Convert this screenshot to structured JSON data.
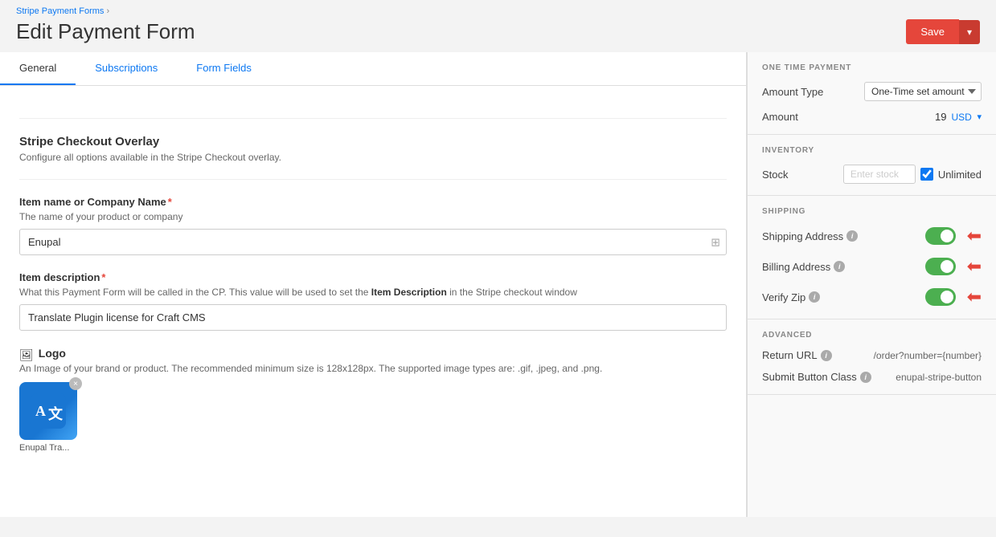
{
  "breadcrumb": {
    "parent": "Stripe Payment Forms",
    "separator": "›"
  },
  "page": {
    "title": "Edit Payment Form"
  },
  "toolbar": {
    "save_label": "Save",
    "save_dropdown_label": "▾"
  },
  "tabs": [
    {
      "id": "general",
      "label": "General",
      "active": true
    },
    {
      "id": "subscriptions",
      "label": "Subscriptions",
      "active": false
    },
    {
      "id": "form-fields",
      "label": "Form Fields",
      "active": false
    }
  ],
  "form": {
    "stripe_checkout": {
      "title": "Stripe Checkout Overlay",
      "subtitle": "Configure all options available in the Stripe Checkout overlay."
    },
    "item_name": {
      "label": "Item name or Company Name",
      "required": true,
      "desc": "The name of your product or company",
      "value": "Enupal"
    },
    "item_description": {
      "label": "Item description",
      "required": true,
      "desc_prefix": "What this Payment Form will be called in the CP. This value will be used to set the ",
      "desc_bold": "Item Description",
      "desc_suffix": " in the Stripe checkout window",
      "value": "Translate Plugin license for Craft CMS"
    },
    "logo": {
      "label": "Logo",
      "icon": "🖼",
      "desc": "An Image of your brand or product. The recommended minimum size is 128x128px. The supported image types are: .gif, .jpeg, and .png.",
      "filename": "Enupal Tra...",
      "remove_label": "×"
    }
  },
  "right_panel": {
    "one_time_payment": {
      "section_title": "ONE TIME PAYMENT",
      "amount_type_label": "Amount Type",
      "amount_type_value": "One-Time set amount",
      "amount_label": "Amount",
      "amount_value": "19",
      "currency": "USD"
    },
    "inventory": {
      "section_title": "INVENTORY",
      "stock_label": "Stock",
      "stock_placeholder": "Enter stock",
      "unlimited_label": "Unlimited",
      "unlimited_checked": true
    },
    "shipping": {
      "section_title": "SHIPPING",
      "shipping_address_label": "Shipping Address",
      "shipping_address_enabled": true,
      "billing_address_label": "Billing Address",
      "billing_address_enabled": true,
      "verify_zip_label": "Verify Zip",
      "verify_zip_enabled": true
    },
    "advanced": {
      "section_title": "ADVANCED",
      "return_url_label": "Return URL",
      "return_url_value": "/order?number={number}",
      "submit_button_class_label": "Submit Button Class",
      "submit_button_class_value": "enupal-stripe-button"
    }
  }
}
